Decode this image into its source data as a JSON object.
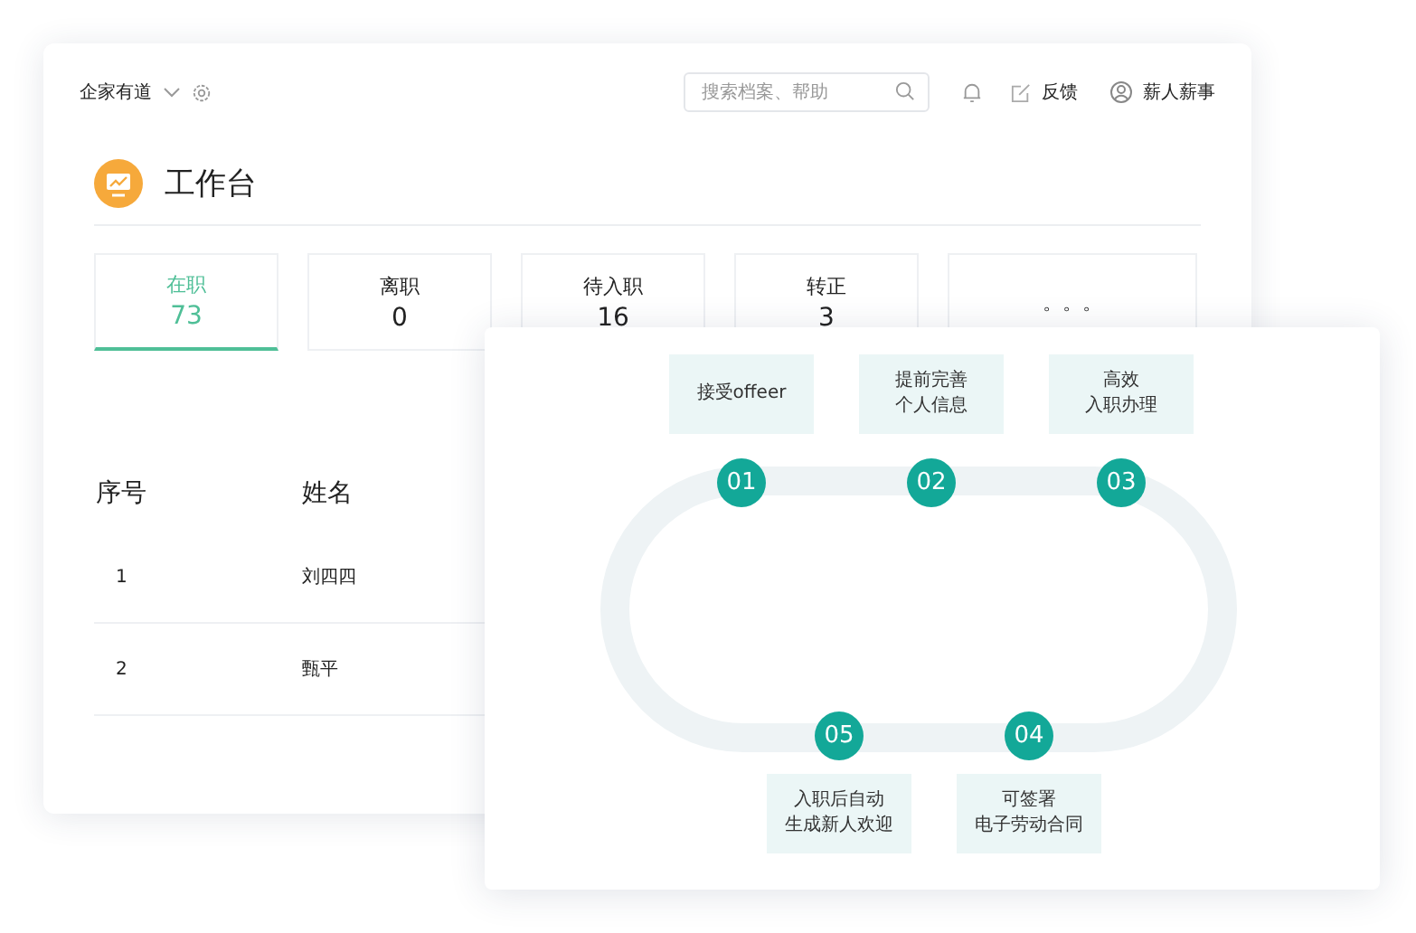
{
  "header": {
    "company": "企家有道",
    "search": {
      "placeholder": "搜索档案、帮助"
    },
    "feedback": "反馈",
    "user": "薪人薪事"
  },
  "page_title": "工作台",
  "stat_tabs": [
    {
      "label": "在职",
      "count": "73",
      "selected": true
    },
    {
      "label": "离职",
      "count": "0",
      "selected": false
    },
    {
      "label": "待入职",
      "count": "16",
      "selected": false
    },
    {
      "label": "转正",
      "count": "3",
      "selected": false
    },
    {
      "label": "。。。",
      "selected": false
    }
  ],
  "table": {
    "columns": [
      "序号",
      "姓名"
    ],
    "rows": [
      [
        "1",
        "刘四四"
      ],
      [
        "2",
        "甄平"
      ]
    ]
  },
  "onboarding_top_steps": [
    {
      "number": "01",
      "lines": [
        "接受offeer"
      ]
    },
    {
      "number": "02",
      "lines": [
        "提前完善",
        "个人信息"
      ]
    },
    {
      "number": "03",
      "lines": [
        "高效",
        "入职办理"
      ]
    }
  ],
  "onboarding_bottom_steps": [
    {
      "number": "05",
      "lines": [
        "入职后自动",
        "生成新人欢迎"
      ]
    },
    {
      "number": "04",
      "lines": [
        "可签署",
        "电子劳动合同"
      ]
    }
  ]
}
